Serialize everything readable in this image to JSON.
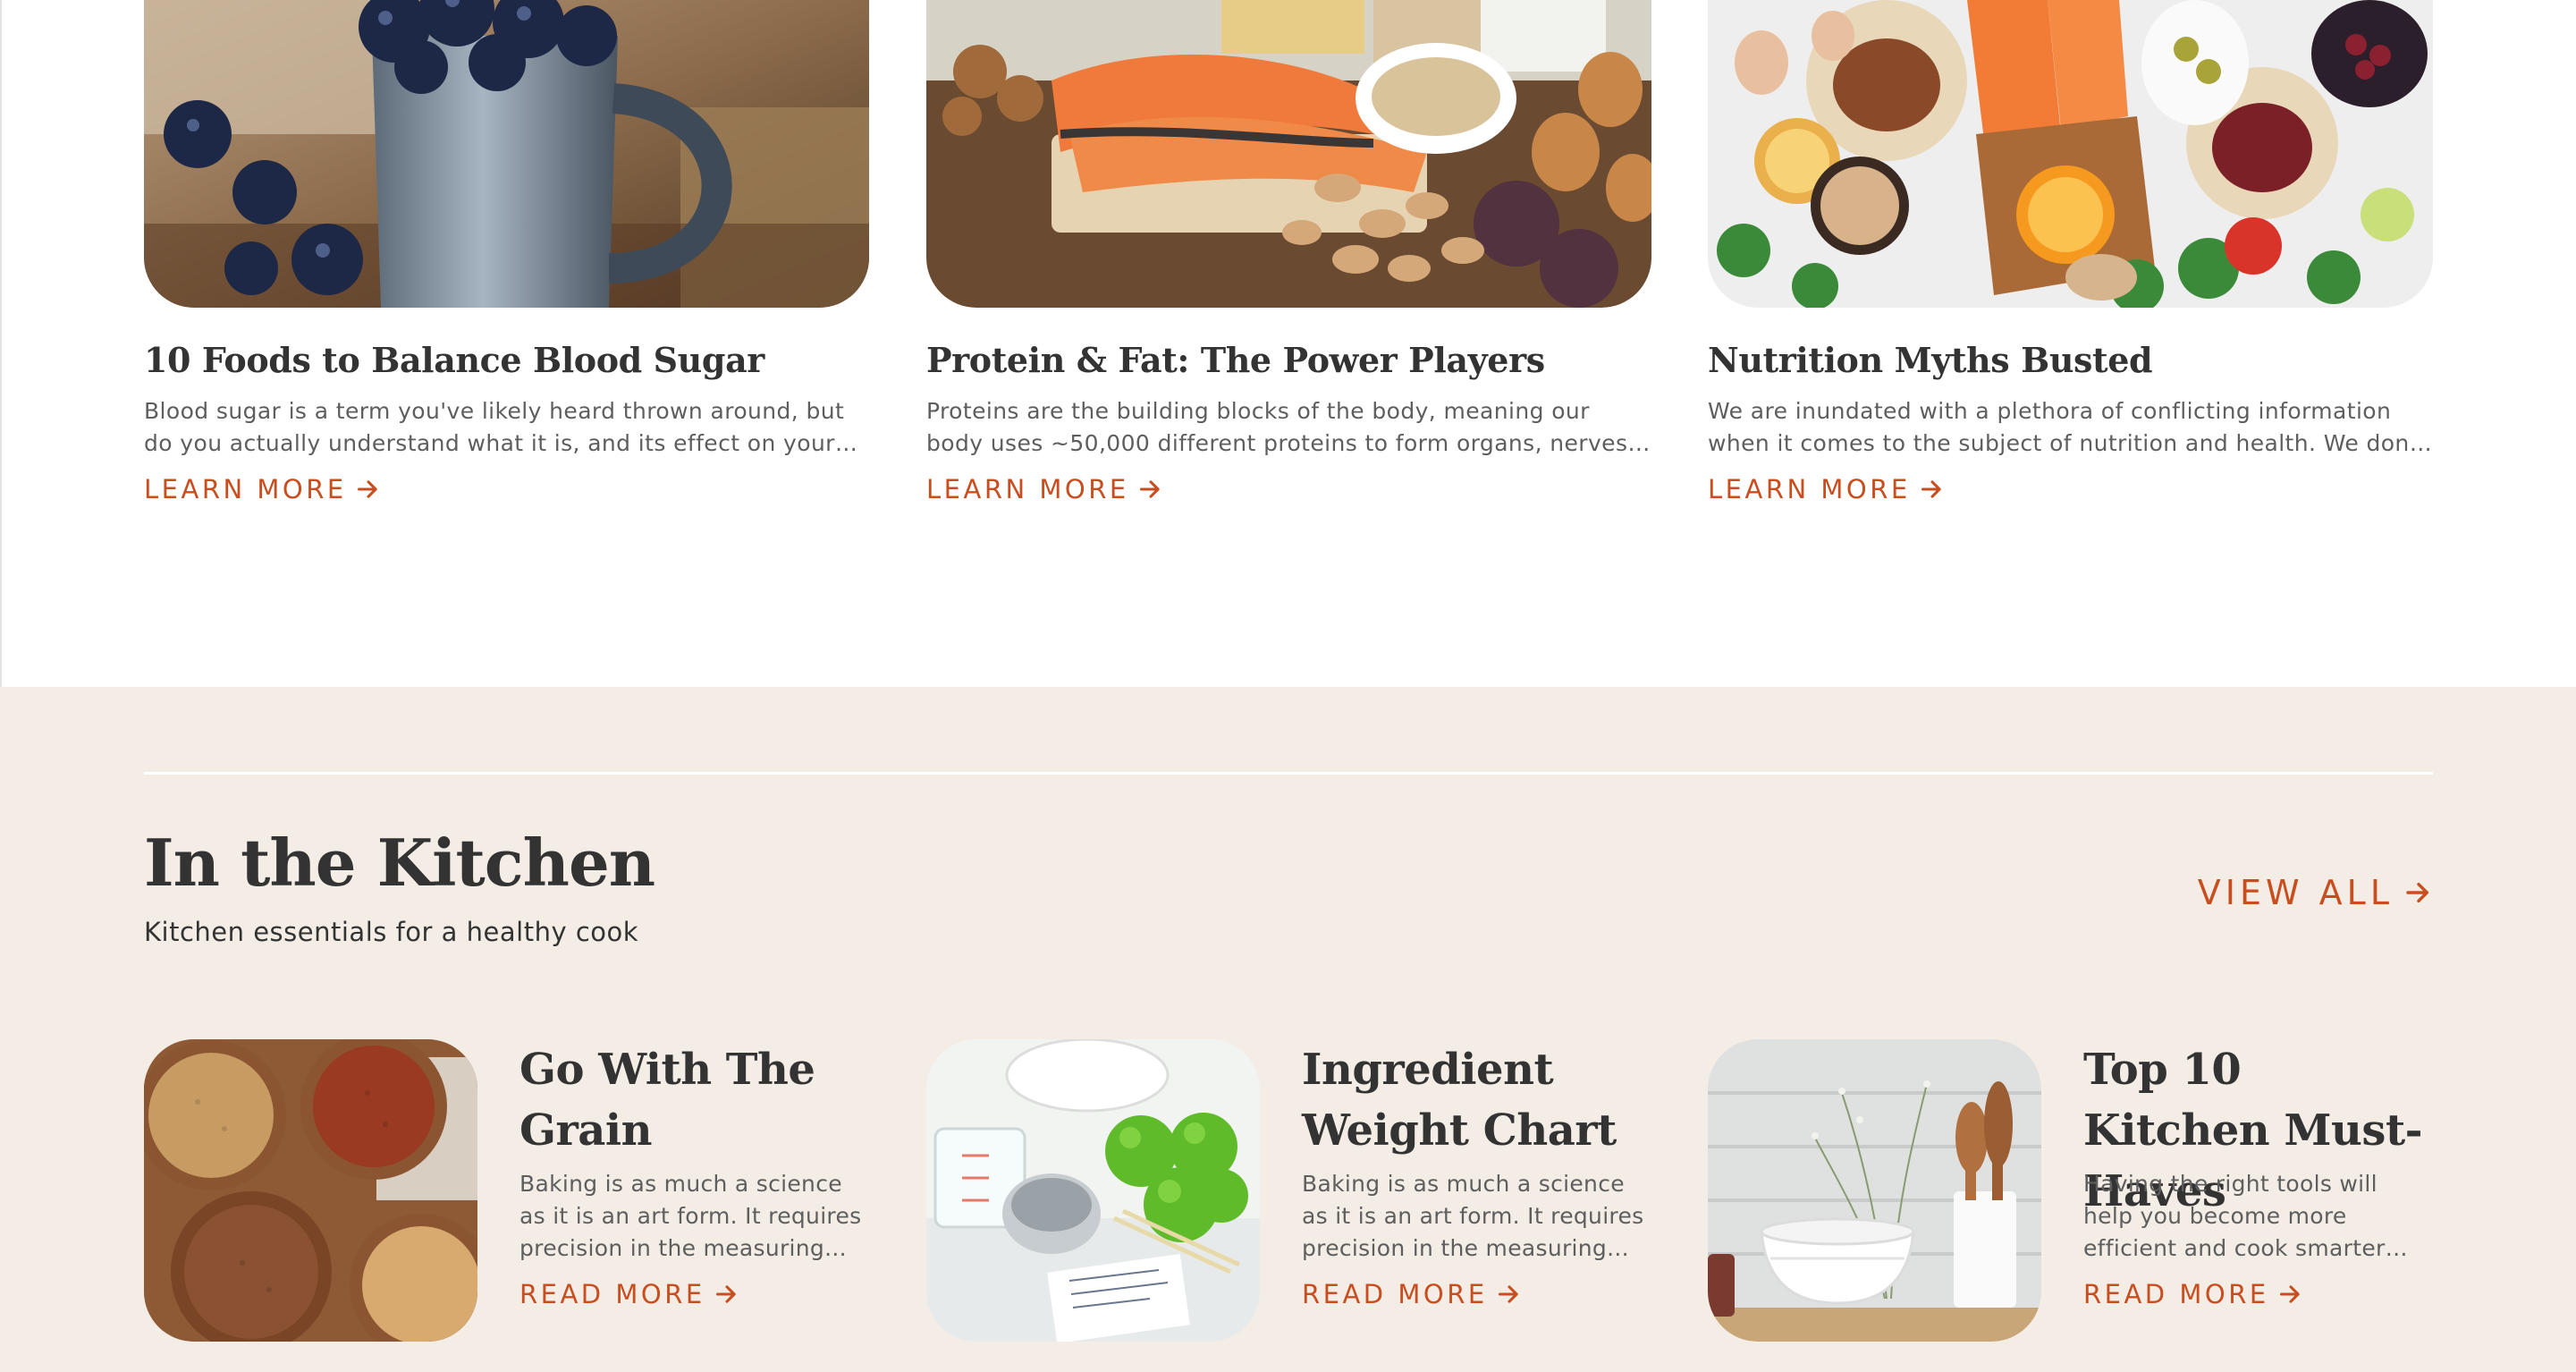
{
  "articles": [
    {
      "title": "10 Foods to Balance Blood Sugar",
      "excerpt": "Blood sugar is a term you've likely heard thrown around, but do you actually understand what it is, and its effect on your body?...",
      "cta": "LEARN MORE",
      "image": "blueberries-in-metal-mug"
    },
    {
      "title": "Protein & Fat: The Power Players",
      "excerpt": "Proteins are the building blocks of the body, meaning our body uses ~50,000 different proteins to form organs, nerves, and...",
      "cta": "LEARN MORE",
      "image": "salmon-eggs-nuts-spread"
    },
    {
      "title": "Nutrition Myths Busted",
      "excerpt": "We are inundated with a plethora of conflicting information when it comes to the subject of nutrition and health. We don't have to...",
      "cta": "LEARN MORE",
      "image": "healthy-foods-flatlay"
    }
  ],
  "kitchen": {
    "heading": "In the Kitchen",
    "subheading": "Kitchen essentials for a healthy cook",
    "view_all": "VIEW ALL",
    "cards": [
      {
        "title": "Go With The Grain",
        "excerpt": "Baking is as much a science as it is an art form. It requires precision in the measuring...",
        "cta": "READ MORE",
        "image": "grains-in-bowls"
      },
      {
        "title": "Ingredient Weight Chart",
        "excerpt": "Baking is as much a science as it is an art form. It requires precision in the measuring...",
        "cta": "READ MORE",
        "image": "apples-measuring-cups"
      },
      {
        "title": "Top 10 Kitchen Must-Haves",
        "excerpt": "Having the right tools will help you become more efficient and cook smarter (not harder) in th...",
        "cta": "READ MORE",
        "image": "white-bowls-wooden-spoons"
      }
    ]
  },
  "colors": {
    "accent": "#c94e1f",
    "heading": "#333333",
    "body_text": "#5e5e5e",
    "section_bg": "#f3ede6"
  },
  "icons": {
    "cta_arrow": "arrow-right-icon"
  }
}
